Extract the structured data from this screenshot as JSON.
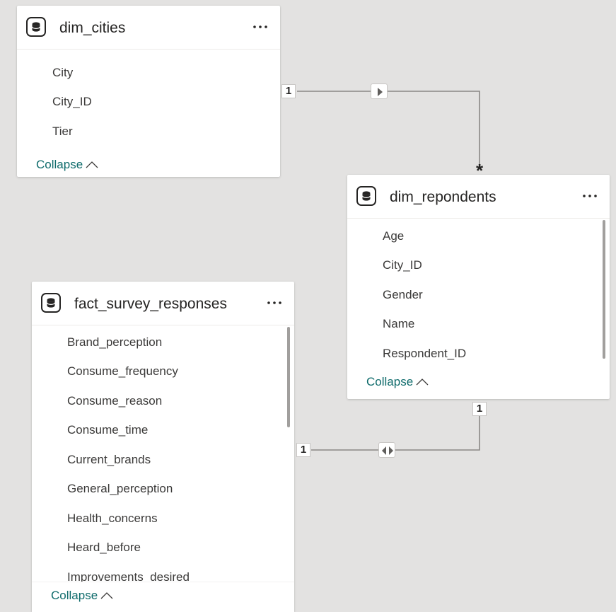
{
  "tables": {
    "dim_cities": {
      "title": "dim_cities",
      "fields": [
        "City",
        "City_ID",
        "Tier"
      ],
      "collapse_label": "Collapse"
    },
    "dim_repondents": {
      "title": "dim_repondents",
      "fields": [
        "Age",
        "City_ID",
        "Gender",
        "Name",
        "Respondent_ID"
      ],
      "collapse_label": "Collapse"
    },
    "fact_survey_responses": {
      "title": "fact_survey_responses",
      "fields": [
        "Brand_perception",
        "Consume_frequency",
        "Consume_reason",
        "Consume_time",
        "Current_brands",
        "General_perception",
        "Health_concerns",
        "Heard_before",
        "Improvements_desired"
      ],
      "collapse_label": "Collapse"
    }
  },
  "relationships": [
    {
      "from": "dim_cities",
      "to": "dim_repondents",
      "from_cardinality": "1",
      "to_cardinality": "*",
      "filter_direction": "single"
    },
    {
      "from": "dim_repondents",
      "to": "fact_survey_responses",
      "from_cardinality": "1",
      "to_cardinality": "1",
      "filter_direction": "both"
    }
  ],
  "icons": {
    "table": "database-icon",
    "more": "more-options-icon",
    "collapse": "chevron-up-icon"
  },
  "colors": {
    "canvas": "#e3e2e1",
    "card": "#ffffff",
    "link": "#0e6b6b",
    "relationship_line": "#8a8886"
  }
}
